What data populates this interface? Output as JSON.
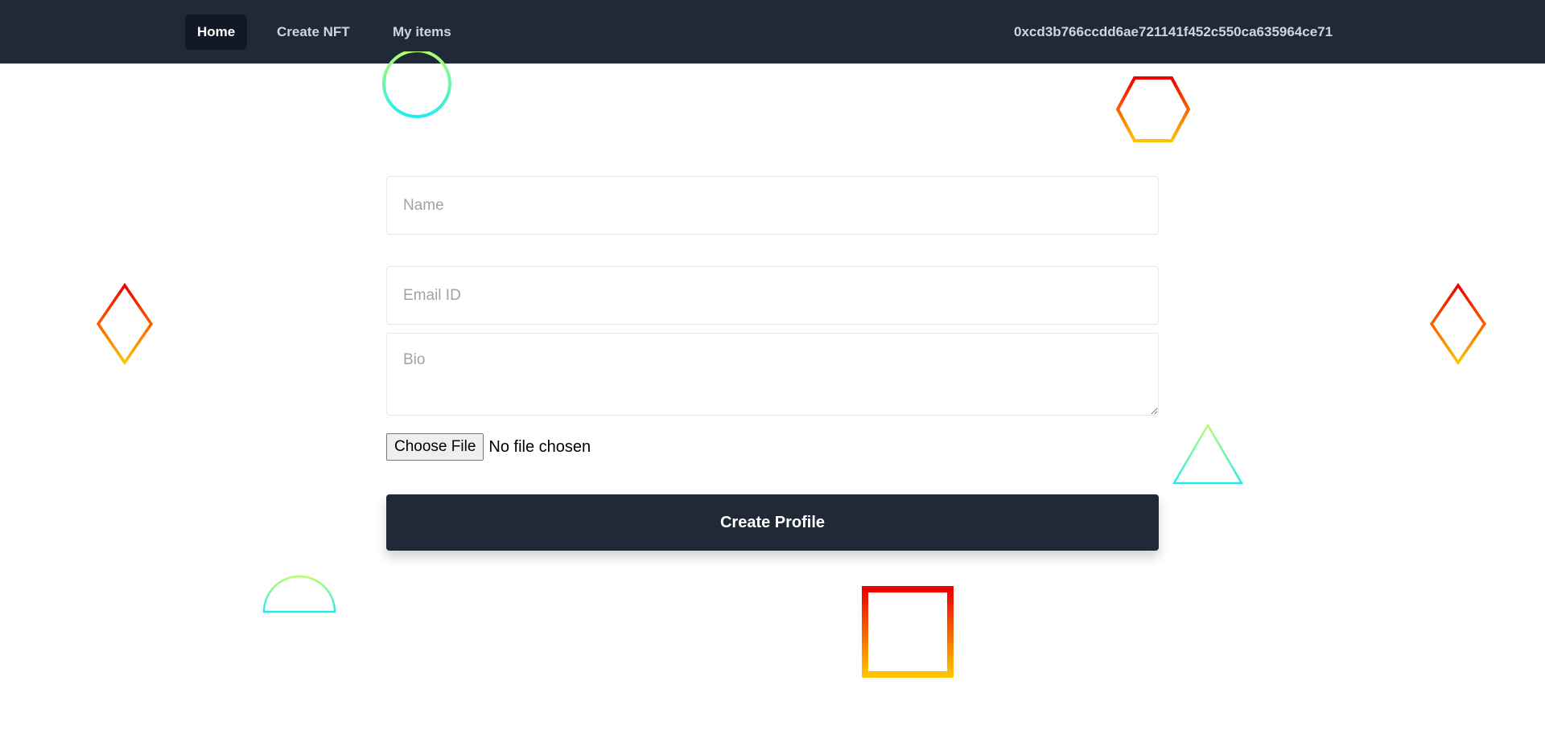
{
  "nav": {
    "items": [
      {
        "label": "Home",
        "active": true
      },
      {
        "label": "Create NFT",
        "active": false
      },
      {
        "label": "My items",
        "active": false
      }
    ],
    "wallet_address": "0xcd3b766ccdd6ae721141f452c550ca635964ce71"
  },
  "form": {
    "name_placeholder": "Name",
    "email_placeholder": "Email ID",
    "bio_placeholder": "Bio",
    "file_button_label": "Choose File",
    "file_status": "No file chosen",
    "submit_label": "Create Profile"
  },
  "colors": {
    "navbar": "#1f2937",
    "active_tab": "#111827",
    "gradient_warm_top": "#ee0000",
    "gradient_warm_bottom": "#ffc400",
    "gradient_cool_top": "#b6ff6a",
    "gradient_cool_bottom": "#22ecf0"
  },
  "decorations": [
    "circle-outline-icon",
    "hexagon-outline-icon",
    "diamond-outline-icon",
    "triangle-outline-icon",
    "semicircle-outline-icon",
    "square-outline-icon"
  ]
}
